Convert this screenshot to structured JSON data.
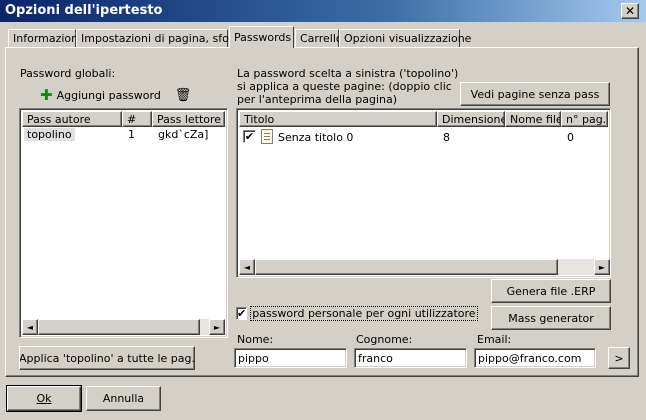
{
  "window": {
    "title": "Opzioni dell'ipertesto"
  },
  "tabs": [
    {
      "label": "Informazioni"
    },
    {
      "label": "Impostazioni di pagina, sfondo"
    },
    {
      "label": "Passwords"
    },
    {
      "label": "Carrello"
    },
    {
      "label": "Opzioni visualizzazione"
    }
  ],
  "active_tab": "Passwords",
  "global_passwords": {
    "label": "Password globali:",
    "add_label": "Aggiungi password",
    "columns": [
      "Pass autore",
      "#",
      "Pass lettore"
    ],
    "rows": [
      {
        "author": "topolino",
        "num": "1",
        "reader": "gkd`cZa]"
      }
    ],
    "apply_button": "Applica 'topolino' a tutte le pag."
  },
  "pages_info": "La password scelta a sinistra ('topolino') si applica a queste pagine: (doppio clic per l'anteprima della pagina)",
  "view_pages_button": "Vedi pagine senza pass",
  "pages_table": {
    "columns": [
      "Titolo",
      "Dimensione",
      "Nome file",
      "n° pag."
    ],
    "rows": [
      {
        "checked": true,
        "title": "Senza titolo 0",
        "size": "8",
        "filename": "",
        "page": "0"
      }
    ]
  },
  "generate_button": "Genera file .ERP",
  "mass_button": "Mass generator",
  "personal_password": {
    "checked": true,
    "label": "password personale per ogni utilizzatore"
  },
  "fields": {
    "nome_label": "Nome:",
    "nome_value": "pippo",
    "cognome_label": "Cognome:",
    "cognome_value": "franco",
    "email_label": "Email:",
    "email_value": "pippo@franco.com",
    "next_symbol": ">"
  },
  "footer": {
    "ok": "Ok",
    "cancel": "Annulla"
  },
  "symbols": {
    "close": "✕",
    "check": "✔",
    "left": "◄",
    "right": "►",
    "plus": "✚",
    "trash": "🗑"
  },
  "colors": {
    "title_start": "#0a246a",
    "title_end": "#a6caf0",
    "face": "#d4d0c8",
    "plus_green": "#118a11"
  }
}
